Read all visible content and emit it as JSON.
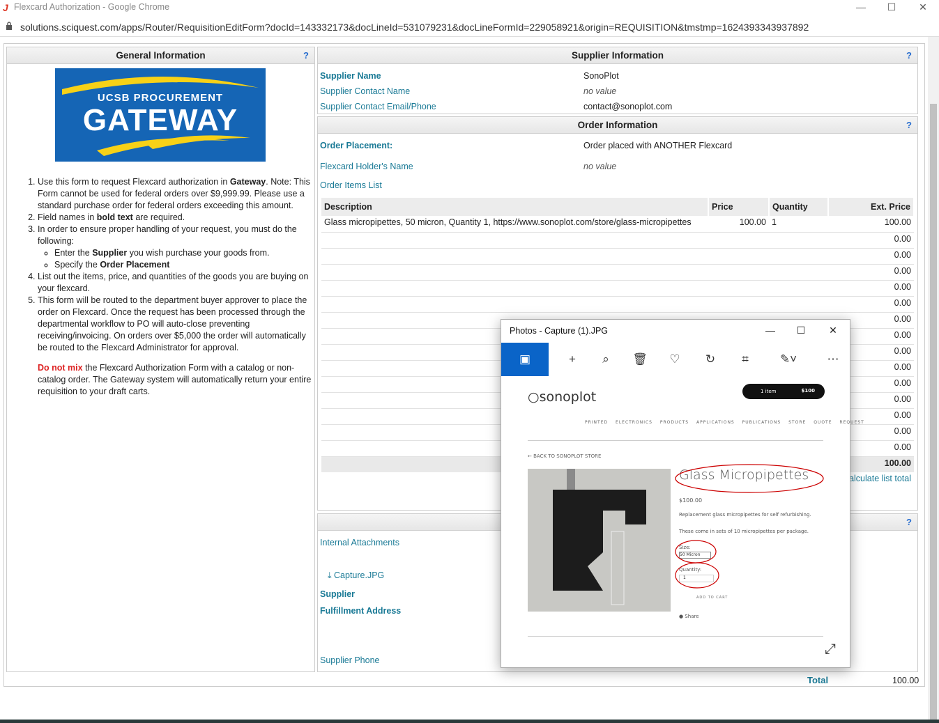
{
  "window": {
    "title": "Flexcard Authorization - Google Chrome",
    "url": "solutions.sciquest.com/apps/Router/RequisitionEditForm?docId=143332173&docLineId=531079231&docLineFormId=229058921&origin=REQUISITION&tmstmp=1624393343937892"
  },
  "general": {
    "header": "General Information",
    "help": "?",
    "logo_top": "UCSB PROCUREMENT",
    "logo_main": "GATEWAY",
    "items": [
      {
        "pre": "Use this form to request Flexcard authorization in ",
        "bold": "Gateway",
        "post": ". Note: This Form cannot be used for federal orders over $9,999.99. Please use a standard purchase order for federal orders exceeding this amount."
      },
      {
        "pre": "Field names in ",
        "bold": "bold text",
        "post": " are required."
      },
      {
        "pre": "In order to ensure proper handling of your request, you must do the following:",
        "bold": "",
        "post": ""
      },
      {
        "pre": "List out the items, price, and quantities of the goods you are buying on your flexcard.",
        "bold": "",
        "post": ""
      },
      {
        "pre": "This form will be routed to the department buyer approver to place the order on Flexcard. Once the request has been processed through the departmental workflow to PO will auto-close preventing receiving/invoicing. On orders over $5,000 the order will automatically be routed to the Flexcard Administrator for approval.",
        "bold": "",
        "post": ""
      }
    ],
    "sub": [
      {
        "pre": "Enter the ",
        "bold": "Supplier",
        "post": " you wish purchase your goods from."
      },
      {
        "pre": "Specify the ",
        "bold": "Order Placement",
        "post": ""
      }
    ],
    "warn_bold": "Do not mix",
    "warn_text": " the Flexcard Authorization Form with a catalog or non-catalog order. The Gateway system will automatically return your entire requisition to your draft carts."
  },
  "supplier": {
    "header": "Supplier Information",
    "help": "?",
    "name_label": "Supplier Name",
    "name_value": "SonoPlot",
    "contact_label": "Supplier Contact Name",
    "contact_value": "no value",
    "email_label": "Supplier Contact Email/Phone",
    "email_value": "contact@sonoplot.com"
  },
  "order": {
    "header": "Order Information",
    "help": "?",
    "placement_label": "Order Placement:",
    "placement_value": "Order placed with ANOTHER Flexcard",
    "holder_label": "Flexcard Holder's Name",
    "holder_value": "no value",
    "list_label": "Order Items List",
    "columns": [
      "Description",
      "Price",
      "Quantity",
      "Ext. Price"
    ],
    "rows": [
      {
        "description": "Glass micropipettes, 50 micron, Quantity 1, https://www.sonoplot.com/store/glass-micropipettes",
        "price": "100.00",
        "quantity": "1",
        "ext": "100.00"
      },
      {
        "description": "",
        "price": "",
        "quantity": "",
        "ext": "0.00"
      },
      {
        "description": "",
        "price": "",
        "quantity": "",
        "ext": "0.00"
      },
      {
        "description": "",
        "price": "",
        "quantity": "",
        "ext": "0.00"
      },
      {
        "description": "",
        "price": "",
        "quantity": "",
        "ext": "0.00"
      },
      {
        "description": "",
        "price": "",
        "quantity": "",
        "ext": "0.00"
      },
      {
        "description": "",
        "price": "",
        "quantity": "",
        "ext": "0.00"
      },
      {
        "description": "",
        "price": "",
        "quantity": "",
        "ext": "0.00"
      },
      {
        "description": "",
        "price": "",
        "quantity": "",
        "ext": "0.00"
      },
      {
        "description": "",
        "price": "",
        "quantity": "",
        "ext": "0.00"
      },
      {
        "description": "",
        "price": "",
        "quantity": "",
        "ext": "0.00"
      },
      {
        "description": "",
        "price": "",
        "quantity": "",
        "ext": "0.00"
      },
      {
        "description": "",
        "price": "",
        "quantity": "",
        "ext": "0.00"
      },
      {
        "description": "",
        "price": "",
        "quantity": "",
        "ext": "0.00"
      },
      {
        "description": "",
        "price": "",
        "quantity": "",
        "ext": "0.00"
      }
    ],
    "sum": "100.00",
    "recalc": "calculate list total"
  },
  "attachments": {
    "help": "?",
    "internal_label": "Internal Attachments",
    "file": "Capture.JPG",
    "supplier_label": "Supplier",
    "fulfillment_label": "Fulfillment Address",
    "phone_label": "Supplier Phone"
  },
  "total": {
    "label": "Total",
    "value": "100.00"
  },
  "photos": {
    "title": "Photos - Capture (1).JPG",
    "brand": "sonoplot",
    "cart_items": "1 item",
    "cart_total": "$100",
    "nav": [
      "PRINTED ELECTRONICS",
      "PRODUCTS",
      "APPLICATIONS",
      "PUBLICATIONS",
      "STORE",
      "QUOTE REQUEST"
    ],
    "back": "← BACK TO SONOPLOT STORE",
    "product": "Glass Micropipettes",
    "price": "$100.00",
    "desc1": "Replacement glass micropipettes for self refurbishing.",
    "desc2": "These come in sets of 10 micropipettes per package.",
    "size_label": "Size:",
    "size_value": "50 Micron",
    "qty_label": "Quantity:",
    "qty_value": "1",
    "add": "ADD TO CART",
    "share": "Share"
  }
}
